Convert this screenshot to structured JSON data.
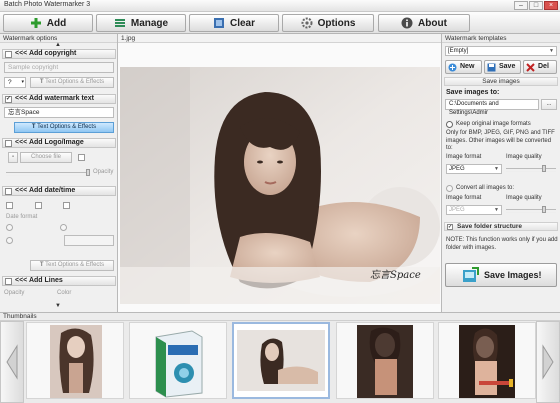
{
  "window": {
    "title": "Batch Photo Watermarker 3"
  },
  "toolbar": {
    "add_label": "Add",
    "manage_label": "Manage",
    "clear_label": "Clear",
    "options_label": "Options",
    "about_label": "About"
  },
  "left": {
    "panel_title": "Watermark options",
    "copyright": {
      "header": "<<< Add copyright",
      "placeholder": "Sample copyright",
      "symbol": "?",
      "text_options": "Text Options & Effects"
    },
    "watermark_text": {
      "header": "<<< Add watermark text",
      "value": "忘言Space",
      "text_options": "Text Options & Effects"
    },
    "logo": {
      "header": "<<< Add Logo/Image",
      "choose_file": "Choose file",
      "opacity": "Opacity"
    },
    "datetime": {
      "header": "<<< Add date/time",
      "date_format": "Date format",
      "text_options": "Text Options & Effects"
    },
    "lines": {
      "header": "<<< Add Lines",
      "opacity": "Opacity",
      "color": "Color"
    }
  },
  "center": {
    "file_label": "1.jpg",
    "watermark_caption": "忘言Space"
  },
  "right": {
    "panel_title": "Watermark templates",
    "template_value": "[Empty]",
    "new_label": "New",
    "save_label": "Save",
    "del_label": "Del",
    "save_images_bar": "Save images",
    "save_images_to": "Save images to:",
    "path_value": "C:\\Documents and Settings\\Admir",
    "browse_label": "...",
    "keep_formats": "Keep original image formats",
    "keep_note": "Only for BMP, JPEG, GIF, PNG and TIFF images. Other images will be converted to:",
    "image_format": "Image format",
    "image_quality": "Image quality",
    "format_value": "JPEG",
    "convert_all": "Convert all images to:",
    "image_format2": "Image format",
    "image_quality2": "Image quality",
    "format_value2": "JPEG",
    "save_folder_structure": "Save folder structure",
    "note": "NOTE: This function works only if you add folder with images.",
    "save_big_label": "Save Images!"
  },
  "thumbnails": {
    "title": "Thumbnails"
  },
  "colors": {
    "accent_blue": "#8fc6f2",
    "toolbar_bg": "#e2e2e2",
    "selected_thumb": "#9bb9df"
  }
}
